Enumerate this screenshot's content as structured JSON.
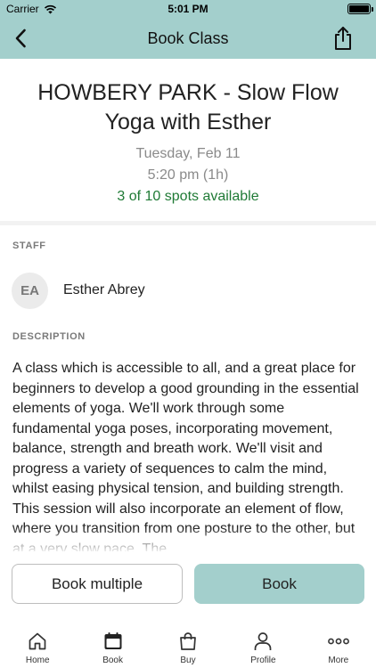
{
  "status_bar": {
    "carrier": "Carrier",
    "time": "5:01 PM"
  },
  "nav": {
    "title": "Book Class",
    "back_icon": "chevron-left-icon",
    "share_icon": "share-icon"
  },
  "class": {
    "title": "HOWBERY PARK - Slow Flow Yoga with Esther",
    "date": "Tuesday, Feb 11",
    "time": "5:20 pm (1h)",
    "spots": "3 of 10 spots available"
  },
  "staff": {
    "label": "STAFF",
    "initials": "EA",
    "name": "Esther Abrey"
  },
  "description": {
    "label": "DESCRIPTION",
    "text": "A class which is accessible to all, and a great place for beginners to develop a good grounding in the essential elements of yoga. We'll work through some fundamental yoga poses, incorporating movement, balance, strength and breath work. We'll visit and progress a variety of sequences to calm the mind, whilst easing physical tension, and building strength. This session will also incorporate an element of flow, where you transition from one posture to the other, but at a very slow pace. The"
  },
  "actions": {
    "book_multiple": "Book multiple",
    "book": "Book"
  },
  "tabs": [
    {
      "label": "Home",
      "icon": "home-icon"
    },
    {
      "label": "Book",
      "icon": "calendar-icon",
      "active": true
    },
    {
      "label": "Buy",
      "icon": "shopping-bag-icon"
    },
    {
      "label": "Profile",
      "icon": "person-icon"
    },
    {
      "label": "More",
      "icon": "more-dots-icon"
    }
  ],
  "colors": {
    "accent": "#a3cfcc",
    "spots_available": "#1f7a35",
    "muted_text": "#8a8a8a"
  }
}
